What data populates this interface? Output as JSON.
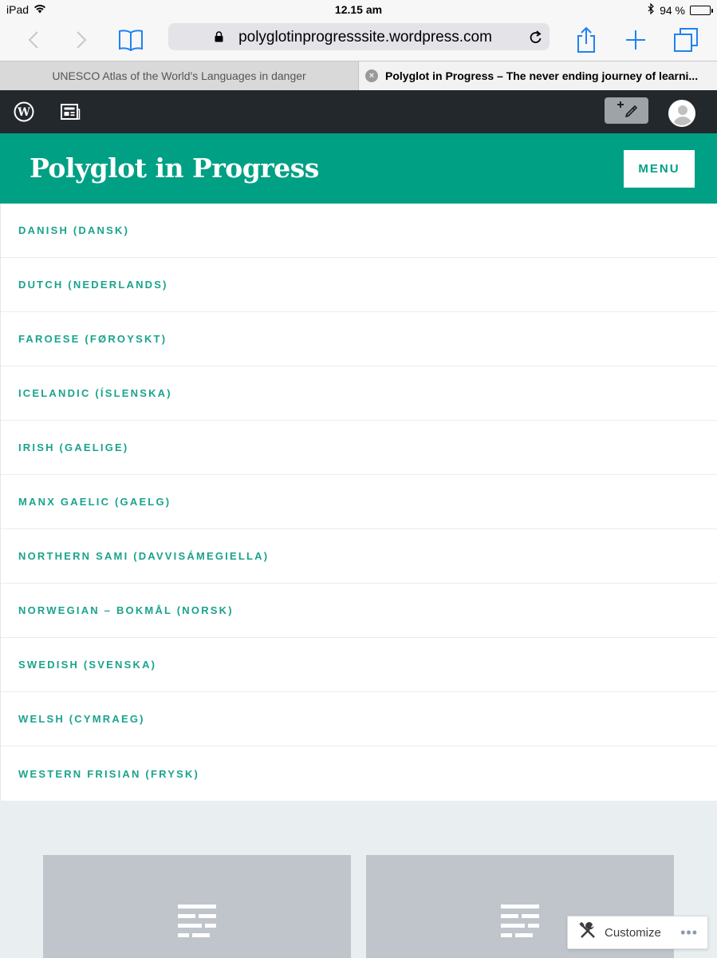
{
  "status_bar": {
    "device": "iPad",
    "time": "12.15 am",
    "battery_text": "94 %",
    "battery_level": 0.94
  },
  "browser": {
    "url": "polyglotinprogresssite.wordpress.com",
    "accent_color": "#1f82f4",
    "icons": [
      "back-icon",
      "forward-icon",
      "bookmarks-icon",
      "lock-icon",
      "reload-icon",
      "share-icon",
      "new-tab-icon",
      "tabs-icon"
    ]
  },
  "tabs": [
    {
      "label": "UNESCO Atlas of the World's Languages in danger",
      "active": false
    },
    {
      "label": "Polyglot in Progress – The never ending journey of learni...",
      "active": true
    }
  ],
  "admin_bar": {
    "icons": [
      "wordpress-logo-icon",
      "reader-icon",
      "write-post-icon",
      "user-avatar-icon"
    ]
  },
  "site": {
    "title": "Polyglot in Progress",
    "menu_label": "MENU",
    "brand_color": "#00a085"
  },
  "menu": {
    "items": [
      {
        "label": "DANISH (DANSK)"
      },
      {
        "label": "DUTCH (NEDERLANDS)"
      },
      {
        "label": "FAROESE (FØROYSKT)"
      },
      {
        "label": "ICELANDIC (ÍSLENSKA)"
      },
      {
        "label": "IRISH (GAELIGE)"
      },
      {
        "label": "MANX GAELIC (GAELG)"
      },
      {
        "label": "NORTHERN SAMI (DAVVISÁMEGIELLA)"
      },
      {
        "label": "NORWEGIAN – BOKMÅL (NORSK)"
      },
      {
        "label": "SWEDISH (SVENSKA)"
      },
      {
        "label": "WELSH (CYMRAEG)"
      },
      {
        "label": "WESTERN FRISIAN (FRYSK)"
      }
    ]
  },
  "customize": {
    "label": "Customize",
    "more": "•••"
  }
}
